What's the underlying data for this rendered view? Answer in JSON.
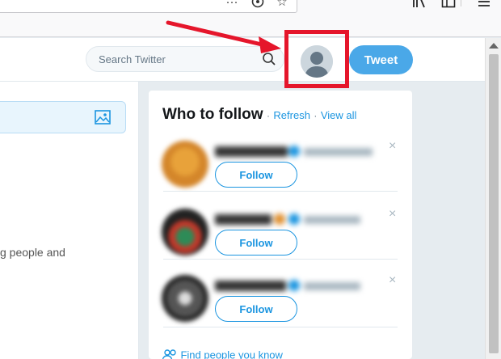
{
  "twitter_nav": {
    "search_placeholder": "Search Twitter",
    "tweet_button_label": "Tweet"
  },
  "timeline": {
    "partial_text": "g people and"
  },
  "who_to_follow": {
    "title": "Who to follow",
    "separator": "·",
    "refresh_label": "Refresh",
    "view_all_label": "View all",
    "follow_label": "Follow",
    "dismiss_glyph": "×",
    "find_people_label": "Find people you know"
  },
  "colors": {
    "twitter_blue": "#1b95e0",
    "tweet_button": "#4aa8e8",
    "highlight_red": "#e5162b"
  }
}
